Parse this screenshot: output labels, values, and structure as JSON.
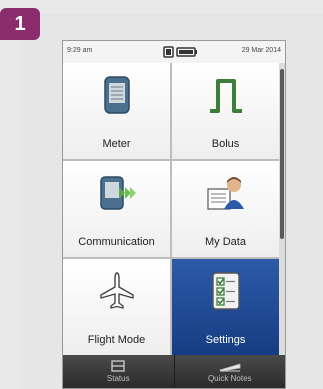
{
  "step_number": "1",
  "status_bar": {
    "time": "9:29 am",
    "date": "29 Mar 2014"
  },
  "tiles": [
    {
      "label": "Meter",
      "icon": "meter-icon"
    },
    {
      "label": "Bolus",
      "icon": "bolus-icon"
    },
    {
      "label": "Communication",
      "icon": "communication-icon"
    },
    {
      "label": "My Data",
      "icon": "my-data-icon"
    },
    {
      "label": "Flight Mode",
      "icon": "airplane-icon"
    },
    {
      "label": "Settings",
      "icon": "settings-checklist-icon",
      "selected": true
    }
  ],
  "bottom_bar": {
    "status_label": "Status",
    "quick_notes_label": "Quick Notes"
  },
  "colors": {
    "step_badge": "#8a2c6d",
    "selected_tile": "#1e4a95",
    "icon_green": "#3f7d3a"
  }
}
